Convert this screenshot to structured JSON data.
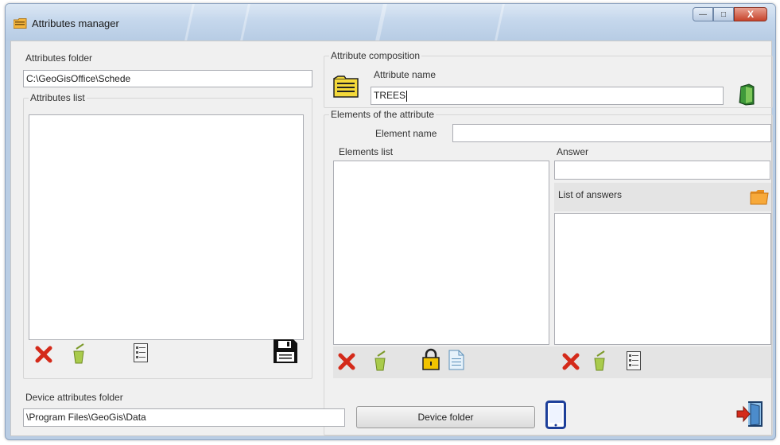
{
  "window": {
    "title": "Attributes manager",
    "controls": {
      "minimize": "—",
      "maximize": "□",
      "close": "X"
    }
  },
  "left": {
    "folder_label": "Attributes folder",
    "folder_value": "C:\\GeoGisOffice\\Schede",
    "list_group_label": "Attributes list",
    "toolbar_icons": [
      "delete-icon",
      "recycle-icon",
      "list-icon",
      "save-icon"
    ]
  },
  "composition": {
    "group_label": "Attribute composition",
    "name_label": "Attribute name",
    "name_value": "TREES",
    "icons": [
      "folder-book-icon",
      "book-icon"
    ]
  },
  "elements": {
    "group_label": "Elements of the attribute",
    "element_name_label": "Element name",
    "element_name_value": "",
    "list_label": "Elements list",
    "answer_label": "Answer",
    "answer_value": "",
    "answers_list_label": "List of answers",
    "list_toolbar_icons": [
      "delete-icon",
      "recycle-icon",
      "lock-icon",
      "document-icon"
    ],
    "answers_toolbar_icons": [
      "delete-icon",
      "recycle-icon",
      "list-icon"
    ]
  },
  "device": {
    "folder_label": "Device attributes folder",
    "folder_value": "\\Program Files\\GeoGis\\Data",
    "folder_button": "Device folder",
    "icons": [
      "tablet-icon",
      "exit-icon"
    ]
  },
  "colors": {
    "delete": "#d42a1a",
    "recycle": "#9ec23d",
    "lock": "#f2c400",
    "folder": "#f4a23a",
    "device": "#1d3f9a"
  }
}
